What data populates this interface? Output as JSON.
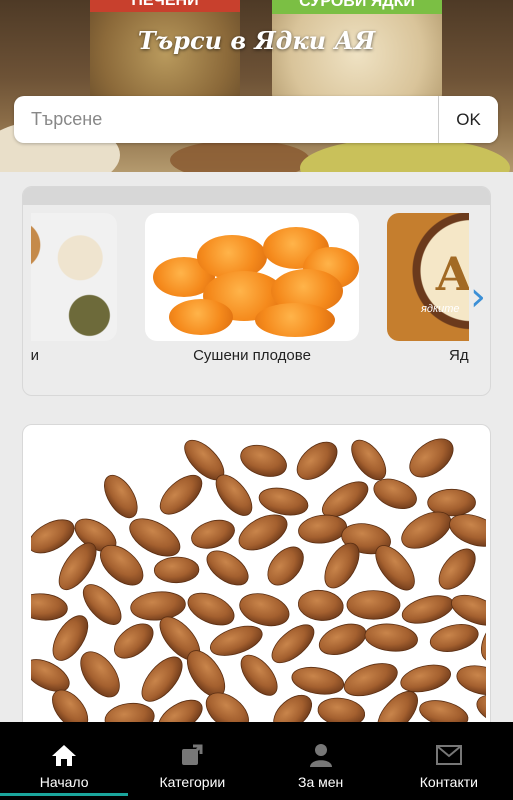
{
  "header": {
    "title": "Търси в Ядки АЯ",
    "bag_left_label": "ПЕЧЕНИ",
    "bag_right_label": "СУРОВИ ЯДКИ"
  },
  "search": {
    "placeholder": "Търсене",
    "value": "",
    "button_label": "OK"
  },
  "categories": {
    "items": [
      {
        "label": "и",
        "image": "mixed-nuts-bowls"
      },
      {
        "label": "Сушени плодове",
        "image": "dried-apricots"
      },
      {
        "label": "Яд",
        "image": "yadkite-logo"
      }
    ],
    "logo_letter": "А",
    "logo_text": "ядките",
    "next_icon": "chevron-right-icon"
  },
  "product": {
    "image": "almonds-pile"
  },
  "nav": {
    "items": [
      {
        "label": "Начало",
        "icon": "home-icon",
        "active": true
      },
      {
        "label": "Категории",
        "icon": "external-link-icon",
        "active": false
      },
      {
        "label": "За мен",
        "icon": "user-icon",
        "active": false
      },
      {
        "label": "Контакти",
        "icon": "envelope-icon",
        "active": false
      }
    ],
    "accent_color": "#1aa59c"
  }
}
